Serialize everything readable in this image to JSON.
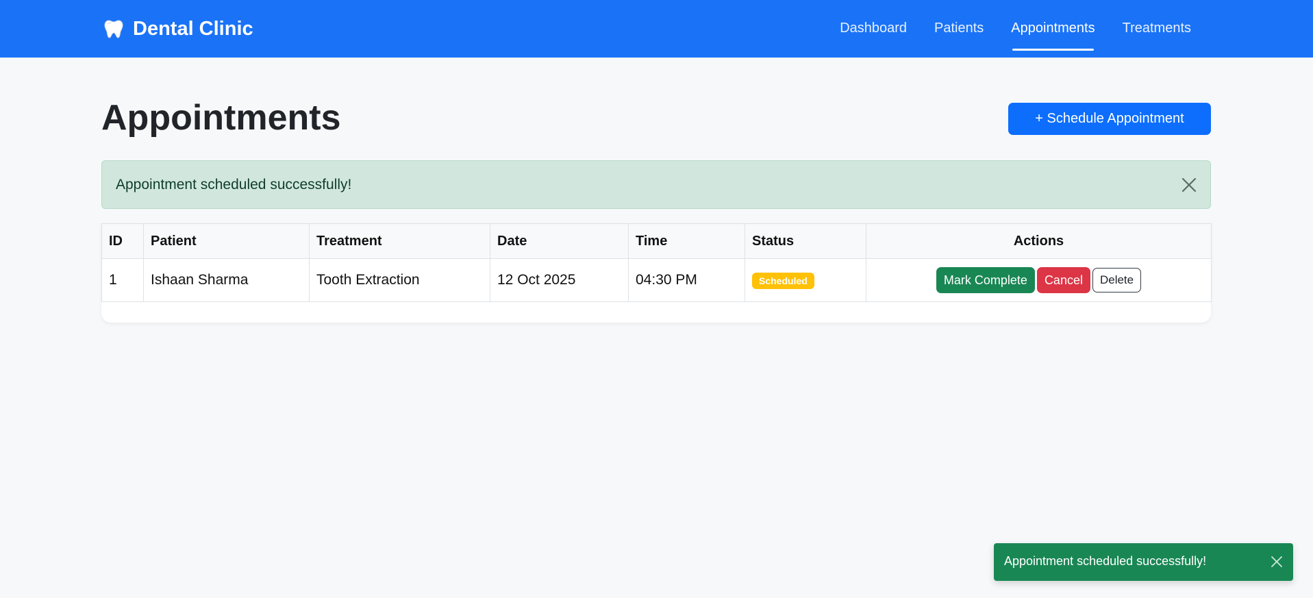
{
  "nav": {
    "brand": "Dental Clinic",
    "brand_icon": "tooth-icon",
    "links": [
      {
        "label": "Dashboard"
      },
      {
        "label": "Patients"
      },
      {
        "label": "Appointments",
        "active": true
      },
      {
        "label": "Treatments"
      }
    ]
  },
  "page": {
    "title": "Appointments",
    "primary_button": "+ Schedule Appointment"
  },
  "alert": {
    "message": "Appointment scheduled successfully!",
    "close_icon": "close-icon"
  },
  "table": {
    "headers": [
      "ID",
      "Patient",
      "Treatment",
      "Date",
      "Time",
      "Status",
      "Actions"
    ],
    "rows": [
      {
        "id": "1",
        "patient": "Ishaan Sharma",
        "treatment": "Tooth Extraction",
        "date": "12 Oct 2025",
        "time": "04:30 PM",
        "status": "Scheduled",
        "actions": {
          "complete": "Mark Complete",
          "cancel": "Cancel",
          "delete": "Delete"
        }
      }
    ]
  },
  "toast": {
    "message": "Appointment scheduled successfully!",
    "close_icon": "close-icon"
  },
  "colors": {
    "navbar": "#1a73f7",
    "primary": "#0d6efd",
    "success": "#198754",
    "danger": "#dc3545",
    "warning": "#ffc107",
    "alert_bg": "#d1e7dd"
  }
}
